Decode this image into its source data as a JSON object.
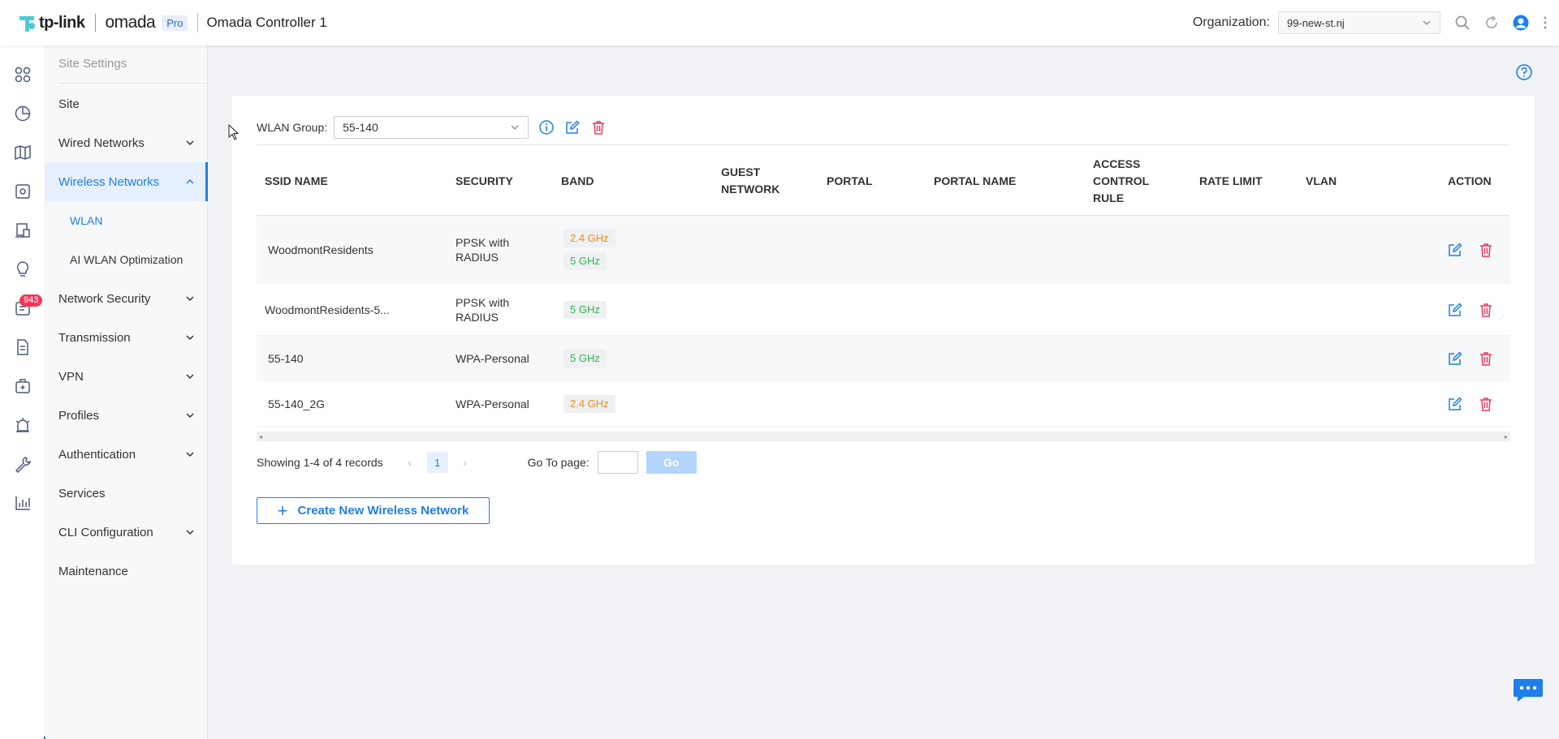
{
  "header": {
    "logo_tp": "tp-link",
    "logo_omada": "omada",
    "pro_badge": "Pro",
    "controller_name": "Omada Controller 1",
    "org_label": "Organization:",
    "org_value": "99-new-st.nj"
  },
  "iconbar": {
    "badge_count": "943",
    "icons": [
      "dashboard-icon",
      "statistics-icon",
      "map-icon",
      "devices-icon",
      "clients-icon",
      "insights-icon",
      "logs-icon",
      "reports-icon",
      "tools-icon",
      "alerts-icon",
      "wrench-icon",
      "analytics-icon",
      "settings-icon"
    ]
  },
  "settings_nav": {
    "title": "Site Settings",
    "items": [
      {
        "label": "Site"
      },
      {
        "label": "Wired Networks"
      },
      {
        "label": "Wireless Networks"
      },
      {
        "label": "WLAN"
      },
      {
        "label": "AI WLAN Optimization"
      },
      {
        "label": "Network Security"
      },
      {
        "label": "Transmission"
      },
      {
        "label": "VPN"
      },
      {
        "label": "Profiles"
      },
      {
        "label": "Authentication"
      },
      {
        "label": "Services"
      },
      {
        "label": "CLI Configuration"
      },
      {
        "label": "Maintenance"
      }
    ]
  },
  "wlan": {
    "group_label": "WLAN Group",
    "group_colon": ":",
    "group_value": "55-140",
    "columns": [
      "SSID NAME",
      "SECURITY",
      "BAND",
      "GUEST NETWORK",
      "PORTAL",
      "PORTAL NAME",
      "ACCESS CONTROL RULE",
      "RATE LIMIT",
      "VLAN",
      "ACTION"
    ],
    "rows": [
      {
        "ssid": "WoodmontResidents",
        "security": "PPSK with RADIUS",
        "bands": [
          "2.4 GHz",
          "5 GHz"
        ]
      },
      {
        "ssid": "WoodmontResidents-5...",
        "security": "PPSK with RADIUS",
        "bands": [
          "5 GHz"
        ]
      },
      {
        "ssid": "55-140",
        "security": "WPA-Personal",
        "bands": [
          "5 GHz"
        ]
      },
      {
        "ssid": "55-140_2G",
        "security": "WPA-Personal",
        "bands": [
          "2.4 GHz"
        ]
      }
    ]
  },
  "pager": {
    "summary": "Showing 1-4 of 4 records",
    "current_page": "1",
    "goto_label": "Go To page:",
    "go_label": "Go"
  },
  "create_button": "Create New Wireless Network",
  "colors": {
    "accent": "#1f7ee8",
    "danger": "#ee385c",
    "band_24": "#f38c19",
    "band_5": "#2db84a"
  }
}
